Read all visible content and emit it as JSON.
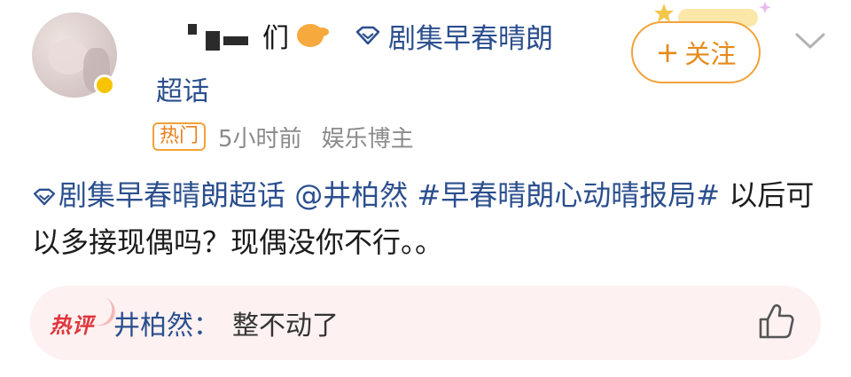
{
  "user": {
    "name_visible_char": "们",
    "super_topic_link": "剧集早春晴朗",
    "super_topic_suffix": "超话"
  },
  "follow_button": {
    "plus": "+",
    "label": "关注"
  },
  "meta": {
    "tag": "热门",
    "time": "5小时前",
    "role": "娱乐博主"
  },
  "post": {
    "topic": "剧集早春晴朗超话",
    "mention": "@井柏然",
    "hashtag_part1": "#早春晴朗心动晴报",
    "hashtag_part2": "局#",
    "text": " 以后可以多接现偶吗？现偶没你不行。。"
  },
  "hot_comment": {
    "badge": "热评",
    "commenter": "井柏然",
    "colon": "：",
    "text": "整不动了"
  },
  "colors": {
    "link_blue": "#2b4f8e",
    "accent_orange": "#f2a23a",
    "hot_red": "#e0363c",
    "comment_bg": "#fdf1f1"
  },
  "icons": [
    "super-topic-diamond-icon",
    "chevron-down-icon",
    "thumbs-up-icon",
    "plus-icon"
  ]
}
